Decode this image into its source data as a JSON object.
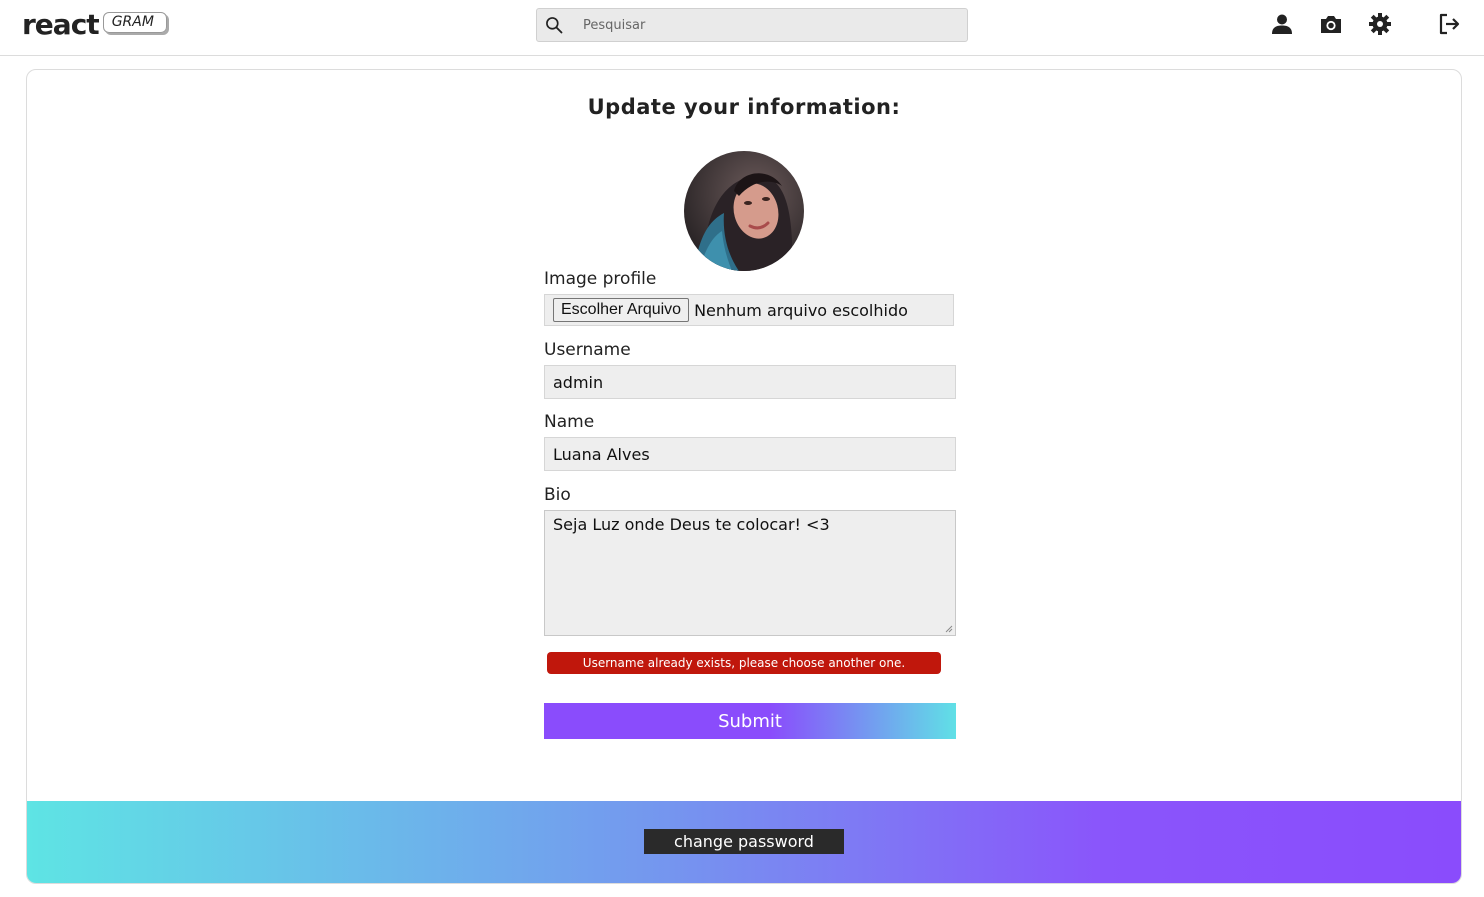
{
  "header": {
    "logo_main": "react",
    "logo_badge": "GRAM",
    "search_placeholder": "Pesquisar",
    "nav_icons": [
      "user-icon",
      "camera-icon",
      "gear-icon",
      "logout-icon"
    ]
  },
  "form": {
    "title": "Update your information:",
    "image_label": "Image profile",
    "file_button": "Escolher Arquivo",
    "file_status": "Nenhum arquivo escolhido",
    "username_label": "Username",
    "username_value": "admin",
    "name_label": "Name",
    "name_value": "Luana Alves",
    "bio_label": "Bio",
    "bio_value": "Seja Luz onde Deus te colocar! <3",
    "error_message": "Username already exists, please choose another one.",
    "submit_label": "Submit"
  },
  "footer": {
    "change_password_label": "change password"
  },
  "colors": {
    "accent_purple": "#8a4cfc",
    "accent_cyan": "#5ee4e4",
    "error_red": "#c0170c"
  }
}
